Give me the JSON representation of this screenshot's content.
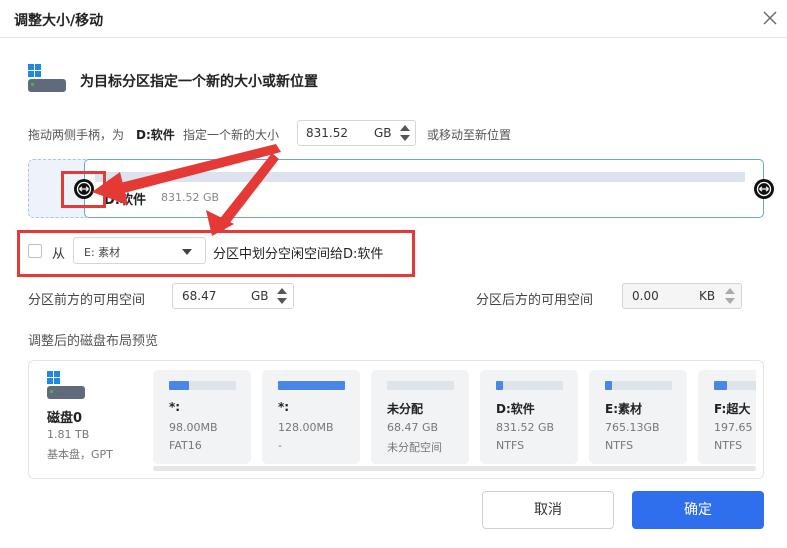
{
  "window": {
    "title": "调整大小/移动"
  },
  "heading": "为目标分区指定一个新的大小或新位置",
  "instruction": {
    "prefix": "拖动两侧手柄，为",
    "target": "D:软件",
    "middle": "指定一个新的大小",
    "size_value": "831.52",
    "size_unit": "GB",
    "suffix": "或移动至新位置"
  },
  "partition": {
    "name": "D:软件",
    "size": "831.52 GB"
  },
  "allocate": {
    "from_label": "从",
    "source_value": "E: 素材",
    "suffix": "分区中划分空闲空间给D:软件"
  },
  "space_before": {
    "label": "分区前方的可用空间",
    "value": "68.47",
    "unit": "GB"
  },
  "space_after": {
    "label": "分区后方的可用空间",
    "value": "0.00",
    "unit": "KB"
  },
  "preview": {
    "title": "调整后的磁盘布局预览",
    "disk": {
      "name": "磁盘0",
      "size": "1.81 TB",
      "type": "基本盘，GPT"
    },
    "partitions": [
      {
        "name": "*:",
        "size": "98.00MB",
        "fs": "FAT16",
        "fill": 0.3,
        "color": "#4a86e8"
      },
      {
        "name": "*:",
        "size": "128.00MB",
        "fs": "-",
        "fill": 1.0,
        "color": "#4a86e8"
      },
      {
        "name": "未分配",
        "size": "68.47 GB",
        "fs": "未分配空间",
        "fill": 0.0,
        "color": "#4a86e8"
      },
      {
        "name": "D:软件",
        "size": "831.52 GB",
        "fs": "NTFS",
        "fill": 0.1,
        "color": "#4a86e8"
      },
      {
        "name": "E:素材",
        "size": "765.13GB",
        "fs": "NTFS",
        "fill": 0.1,
        "color": "#4a86e8"
      },
      {
        "name": "F:超大",
        "size": "197.65",
        "fs": "NTFS",
        "fill": 0.2,
        "color": "#4a86e8"
      }
    ]
  },
  "buttons": {
    "cancel": "取消",
    "ok": "确定"
  },
  "colors": {
    "primary": "#2f6fed",
    "annotation": "#e53935"
  }
}
